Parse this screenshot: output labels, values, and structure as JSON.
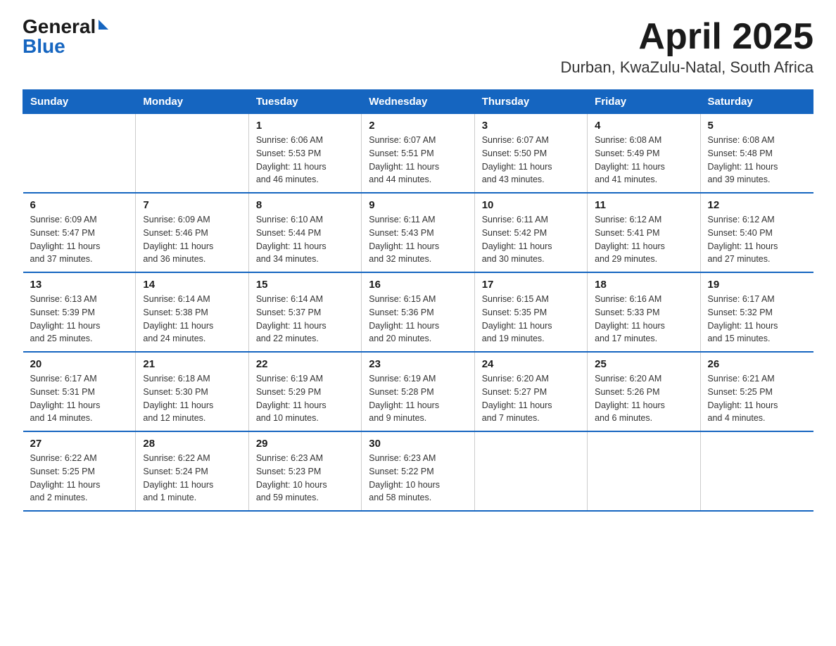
{
  "logo": {
    "general": "General",
    "blue": "Blue"
  },
  "title": "April 2025",
  "subtitle": "Durban, KwaZulu-Natal, South Africa",
  "days_of_week": [
    "Sunday",
    "Monday",
    "Tuesday",
    "Wednesday",
    "Thursday",
    "Friday",
    "Saturday"
  ],
  "weeks": [
    [
      {
        "day": "",
        "info": ""
      },
      {
        "day": "",
        "info": ""
      },
      {
        "day": "1",
        "info": "Sunrise: 6:06 AM\nSunset: 5:53 PM\nDaylight: 11 hours\nand 46 minutes."
      },
      {
        "day": "2",
        "info": "Sunrise: 6:07 AM\nSunset: 5:51 PM\nDaylight: 11 hours\nand 44 minutes."
      },
      {
        "day": "3",
        "info": "Sunrise: 6:07 AM\nSunset: 5:50 PM\nDaylight: 11 hours\nand 43 minutes."
      },
      {
        "day": "4",
        "info": "Sunrise: 6:08 AM\nSunset: 5:49 PM\nDaylight: 11 hours\nand 41 minutes."
      },
      {
        "day": "5",
        "info": "Sunrise: 6:08 AM\nSunset: 5:48 PM\nDaylight: 11 hours\nand 39 minutes."
      }
    ],
    [
      {
        "day": "6",
        "info": "Sunrise: 6:09 AM\nSunset: 5:47 PM\nDaylight: 11 hours\nand 37 minutes."
      },
      {
        "day": "7",
        "info": "Sunrise: 6:09 AM\nSunset: 5:46 PM\nDaylight: 11 hours\nand 36 minutes."
      },
      {
        "day": "8",
        "info": "Sunrise: 6:10 AM\nSunset: 5:44 PM\nDaylight: 11 hours\nand 34 minutes."
      },
      {
        "day": "9",
        "info": "Sunrise: 6:11 AM\nSunset: 5:43 PM\nDaylight: 11 hours\nand 32 minutes."
      },
      {
        "day": "10",
        "info": "Sunrise: 6:11 AM\nSunset: 5:42 PM\nDaylight: 11 hours\nand 30 minutes."
      },
      {
        "day": "11",
        "info": "Sunrise: 6:12 AM\nSunset: 5:41 PM\nDaylight: 11 hours\nand 29 minutes."
      },
      {
        "day": "12",
        "info": "Sunrise: 6:12 AM\nSunset: 5:40 PM\nDaylight: 11 hours\nand 27 minutes."
      }
    ],
    [
      {
        "day": "13",
        "info": "Sunrise: 6:13 AM\nSunset: 5:39 PM\nDaylight: 11 hours\nand 25 minutes."
      },
      {
        "day": "14",
        "info": "Sunrise: 6:14 AM\nSunset: 5:38 PM\nDaylight: 11 hours\nand 24 minutes."
      },
      {
        "day": "15",
        "info": "Sunrise: 6:14 AM\nSunset: 5:37 PM\nDaylight: 11 hours\nand 22 minutes."
      },
      {
        "day": "16",
        "info": "Sunrise: 6:15 AM\nSunset: 5:36 PM\nDaylight: 11 hours\nand 20 minutes."
      },
      {
        "day": "17",
        "info": "Sunrise: 6:15 AM\nSunset: 5:35 PM\nDaylight: 11 hours\nand 19 minutes."
      },
      {
        "day": "18",
        "info": "Sunrise: 6:16 AM\nSunset: 5:33 PM\nDaylight: 11 hours\nand 17 minutes."
      },
      {
        "day": "19",
        "info": "Sunrise: 6:17 AM\nSunset: 5:32 PM\nDaylight: 11 hours\nand 15 minutes."
      }
    ],
    [
      {
        "day": "20",
        "info": "Sunrise: 6:17 AM\nSunset: 5:31 PM\nDaylight: 11 hours\nand 14 minutes."
      },
      {
        "day": "21",
        "info": "Sunrise: 6:18 AM\nSunset: 5:30 PM\nDaylight: 11 hours\nand 12 minutes."
      },
      {
        "day": "22",
        "info": "Sunrise: 6:19 AM\nSunset: 5:29 PM\nDaylight: 11 hours\nand 10 minutes."
      },
      {
        "day": "23",
        "info": "Sunrise: 6:19 AM\nSunset: 5:28 PM\nDaylight: 11 hours\nand 9 minutes."
      },
      {
        "day": "24",
        "info": "Sunrise: 6:20 AM\nSunset: 5:27 PM\nDaylight: 11 hours\nand 7 minutes."
      },
      {
        "day": "25",
        "info": "Sunrise: 6:20 AM\nSunset: 5:26 PM\nDaylight: 11 hours\nand 6 minutes."
      },
      {
        "day": "26",
        "info": "Sunrise: 6:21 AM\nSunset: 5:25 PM\nDaylight: 11 hours\nand 4 minutes."
      }
    ],
    [
      {
        "day": "27",
        "info": "Sunrise: 6:22 AM\nSunset: 5:25 PM\nDaylight: 11 hours\nand 2 minutes."
      },
      {
        "day": "28",
        "info": "Sunrise: 6:22 AM\nSunset: 5:24 PM\nDaylight: 11 hours\nand 1 minute."
      },
      {
        "day": "29",
        "info": "Sunrise: 6:23 AM\nSunset: 5:23 PM\nDaylight: 10 hours\nand 59 minutes."
      },
      {
        "day": "30",
        "info": "Sunrise: 6:23 AM\nSunset: 5:22 PM\nDaylight: 10 hours\nand 58 minutes."
      },
      {
        "day": "",
        "info": ""
      },
      {
        "day": "",
        "info": ""
      },
      {
        "day": "",
        "info": ""
      }
    ]
  ]
}
